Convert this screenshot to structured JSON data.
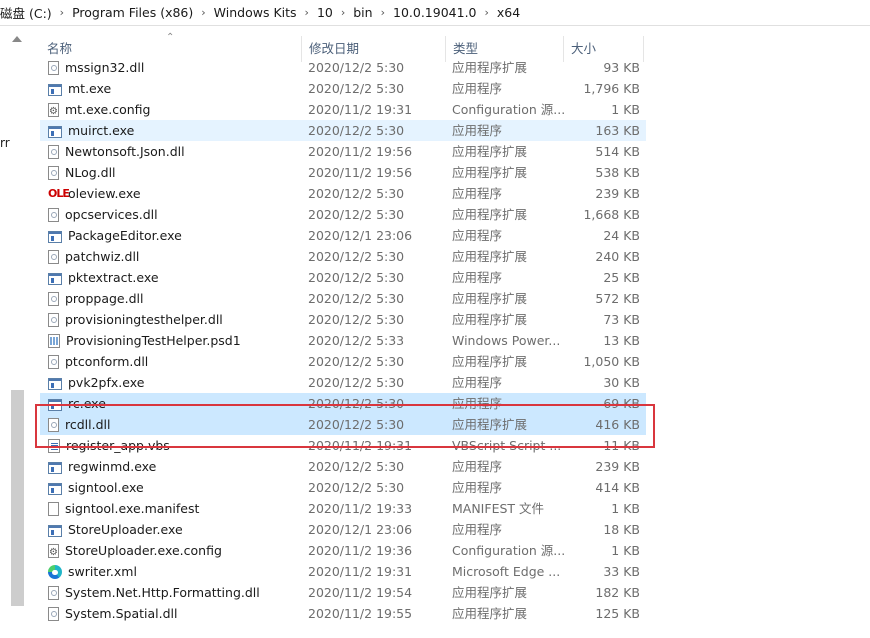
{
  "breadcrumb": [
    {
      "label": "磁盘 (C:)"
    },
    {
      "label": "Program Files (x86)"
    },
    {
      "label": "Windows Kits"
    },
    {
      "label": "10"
    },
    {
      "label": "bin"
    },
    {
      "label": "10.0.19041.0"
    },
    {
      "label": "x64"
    }
  ],
  "left_fragment": "rr",
  "columns": {
    "name": "名称",
    "date": "修改日期",
    "type": "类型",
    "size": "大小"
  },
  "files": [
    {
      "name": "mssign32.dll",
      "date": "2020/12/2 5:30",
      "type": "应用程序扩展",
      "size": "93 KB",
      "icon": "dll"
    },
    {
      "name": "mt.exe",
      "date": "2020/12/2 5:30",
      "type": "应用程序",
      "size": "1,796 KB",
      "icon": "exe"
    },
    {
      "name": "mt.exe.config",
      "date": "2020/11/2 19:31",
      "type": "Configuration 源...",
      "size": "1 KB",
      "icon": "config"
    },
    {
      "name": "muirct.exe",
      "date": "2020/12/2 5:30",
      "type": "应用程序",
      "size": "163 KB",
      "icon": "exe"
    },
    {
      "name": "Newtonsoft.Json.dll",
      "date": "2020/11/2 19:56",
      "type": "应用程序扩展",
      "size": "514 KB",
      "icon": "dll"
    },
    {
      "name": "NLog.dll",
      "date": "2020/11/2 19:56",
      "type": "应用程序扩展",
      "size": "538 KB",
      "icon": "dll"
    },
    {
      "name": "oleview.exe",
      "date": "2020/12/2 5:30",
      "type": "应用程序",
      "size": "239 KB",
      "icon": "oleview"
    },
    {
      "name": "opcservices.dll",
      "date": "2020/12/2 5:30",
      "type": "应用程序扩展",
      "size": "1,668 KB",
      "icon": "dll"
    },
    {
      "name": "PackageEditor.exe",
      "date": "2020/12/1 23:06",
      "type": "应用程序",
      "size": "24 KB",
      "icon": "exe"
    },
    {
      "name": "patchwiz.dll",
      "date": "2020/12/2 5:30",
      "type": "应用程序扩展",
      "size": "240 KB",
      "icon": "dll"
    },
    {
      "name": "pktextract.exe",
      "date": "2020/12/2 5:30",
      "type": "应用程序",
      "size": "25 KB",
      "icon": "exe"
    },
    {
      "name": "proppage.dll",
      "date": "2020/12/2 5:30",
      "type": "应用程序扩展",
      "size": "572 KB",
      "icon": "dll"
    },
    {
      "name": "provisioningtesthelper.dll",
      "date": "2020/12/2 5:30",
      "type": "应用程序扩展",
      "size": "73 KB",
      "icon": "dll"
    },
    {
      "name": "ProvisioningTestHelper.psd1",
      "date": "2020/12/2 5:33",
      "type": "Windows Power...",
      "size": "13 KB",
      "icon": "ps"
    },
    {
      "name": "ptconform.dll",
      "date": "2020/12/2 5:30",
      "type": "应用程序扩展",
      "size": "1,050 KB",
      "icon": "dll"
    },
    {
      "name": "pvk2pfx.exe",
      "date": "2020/12/2 5:30",
      "type": "应用程序",
      "size": "30 KB",
      "icon": "exe"
    },
    {
      "name": "rc.exe",
      "date": "2020/12/2 5:30",
      "type": "应用程序",
      "size": "69 KB",
      "icon": "exe"
    },
    {
      "name": "rcdll.dll",
      "date": "2020/12/2 5:30",
      "type": "应用程序扩展",
      "size": "416 KB",
      "icon": "dll"
    },
    {
      "name": "register_app.vbs",
      "date": "2020/11/2 19:31",
      "type": "VBScript Script ...",
      "size": "11 KB",
      "icon": "vbs"
    },
    {
      "name": "regwinmd.exe",
      "date": "2020/12/2 5:30",
      "type": "应用程序",
      "size": "239 KB",
      "icon": "exe"
    },
    {
      "name": "signtool.exe",
      "date": "2020/12/2 5:30",
      "type": "应用程序",
      "size": "414 KB",
      "icon": "exe"
    },
    {
      "name": "signtool.exe.manifest",
      "date": "2020/11/2 19:33",
      "type": "MANIFEST 文件",
      "size": "1 KB",
      "icon": "manifest"
    },
    {
      "name": "StoreUploader.exe",
      "date": "2020/12/1 23:06",
      "type": "应用程序",
      "size": "18 KB",
      "icon": "exe"
    },
    {
      "name": "StoreUploader.exe.config",
      "date": "2020/11/2 19:36",
      "type": "Configuration 源...",
      "size": "1 KB",
      "icon": "config"
    },
    {
      "name": "swriter.xml",
      "date": "2020/11/2 19:31",
      "type": "Microsoft Edge ...",
      "size": "33 KB",
      "icon": "edge"
    },
    {
      "name": "System.Net.Http.Formatting.dll",
      "date": "2020/11/2 19:54",
      "type": "应用程序扩展",
      "size": "182 KB",
      "icon": "dll"
    },
    {
      "name": "System.Spatial.dll",
      "date": "2020/11/2 19:55",
      "type": "应用程序扩展",
      "size": "125 KB",
      "icon": "dll"
    }
  ],
  "hovered_row": "muirct.exe",
  "selected_rows": [
    "rc.exe",
    "rcdll.dll"
  ],
  "colors": {
    "selection": "#cce8ff",
    "hover": "#e5f3ff",
    "annotation_box": "#d9363e",
    "header_text": "#4c607a"
  }
}
